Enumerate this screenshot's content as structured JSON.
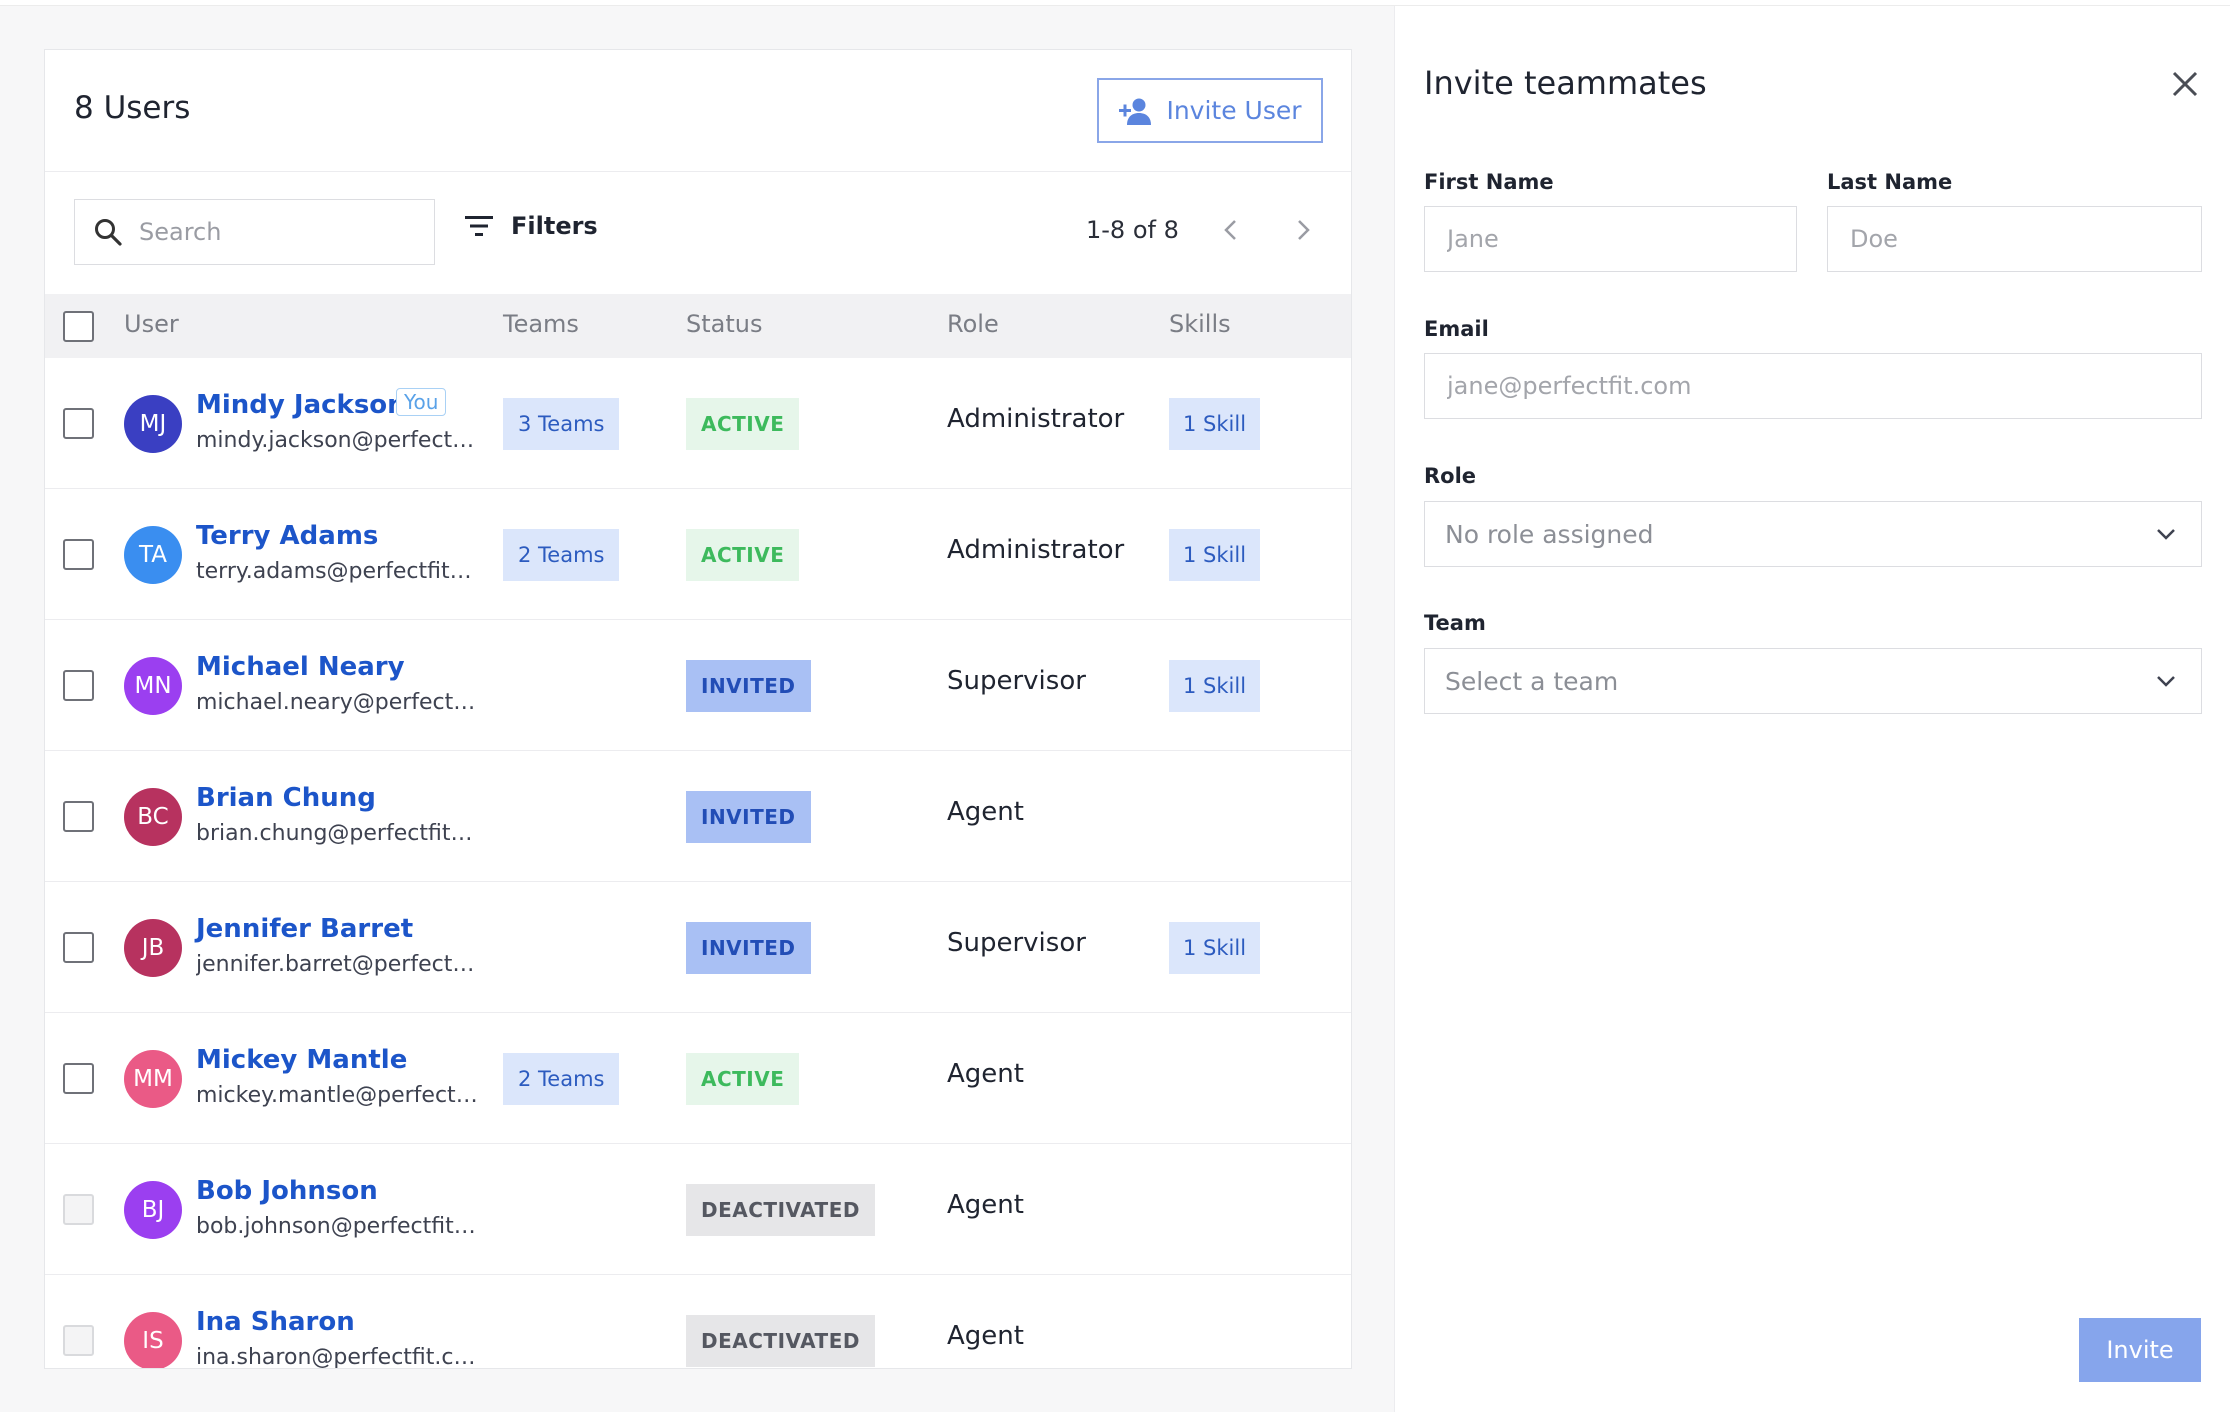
{
  "users_card": {
    "title": "8 Users",
    "invite_button_label": "Invite User",
    "search_placeholder": "Search",
    "filters_label": "Filters",
    "pagination": "1-8 of 8"
  },
  "table": {
    "columns": {
      "user": "User",
      "teams": "Teams",
      "status": "Status",
      "role": "Role",
      "skills": "Skills"
    },
    "rows": [
      {
        "initials": "MJ",
        "avatar_color": "#3a3fc2",
        "name": "Mindy Jackson",
        "you_badge": "You",
        "email": "mindy.jackson@perfectfit.com",
        "teams": "3 Teams",
        "status": "ACTIVE",
        "status_kind": "active",
        "role": "Administrator",
        "skills": "1 Skill",
        "selectable": true
      },
      {
        "initials": "TA",
        "avatar_color": "#3a8ef0",
        "name": "Terry Adams",
        "email": "terry.adams@perfectfit.com",
        "teams": "2 Teams",
        "status": "ACTIVE",
        "status_kind": "active",
        "role": "Administrator",
        "skills": "1 Skill",
        "selectable": true
      },
      {
        "initials": "MN",
        "avatar_color": "#9b3ff0",
        "name": "Michael Neary",
        "email": "michael.neary@perfectfit.com",
        "teams": "",
        "status": "INVITED",
        "status_kind": "invited",
        "role": "Supervisor",
        "skills": "1 Skill",
        "selectable": true
      },
      {
        "initials": "BC",
        "avatar_color": "#b7325f",
        "name": "Brian Chung",
        "email": "brian.chung@perfectfit.com",
        "teams": "",
        "status": "INVITED",
        "status_kind": "invited",
        "role": "Agent",
        "skills": "",
        "selectable": true
      },
      {
        "initials": "JB",
        "avatar_color": "#b7325f",
        "name": "Jennifer Barret",
        "email": "jennifer.barret@perfectfit.com",
        "teams": "",
        "status": "INVITED",
        "status_kind": "invited",
        "role": "Supervisor",
        "skills": "1 Skill",
        "selectable": true
      },
      {
        "initials": "MM",
        "avatar_color": "#ea5a86",
        "name": "Mickey Mantle",
        "email": "mickey.mantle@perfectfit.com",
        "teams": "2 Teams",
        "status": "ACTIVE",
        "status_kind": "active",
        "role": "Agent",
        "skills": "",
        "selectable": true
      },
      {
        "initials": "BJ",
        "avatar_color": "#9b3ff0",
        "name": "Bob Johnson",
        "email": "bob.johnson@perfectfit.com",
        "teams": "",
        "status": "DEACTIVATED",
        "status_kind": "deactivated",
        "role": "Agent",
        "skills": "",
        "selectable": false
      },
      {
        "initials": "IS",
        "avatar_color": "#ea5a86",
        "name": "Ina Sharon",
        "email": "ina.sharon@perfectfit.com",
        "teams": "",
        "status": "DEACTIVATED",
        "status_kind": "deactivated",
        "role": "Agent",
        "skills": "",
        "selectable": false
      }
    ]
  },
  "invite_panel": {
    "title": "Invite teammates",
    "first_name_label": "First Name",
    "first_name_placeholder": "Jane",
    "last_name_label": "Last Name",
    "last_name_placeholder": "Doe",
    "email_label": "Email",
    "email_placeholder": "jane@perfectfit.com",
    "role_label": "Role",
    "role_value": "No role assigned",
    "team_label": "Team",
    "team_value": "Select a team",
    "invite_button_label": "Invite"
  }
}
